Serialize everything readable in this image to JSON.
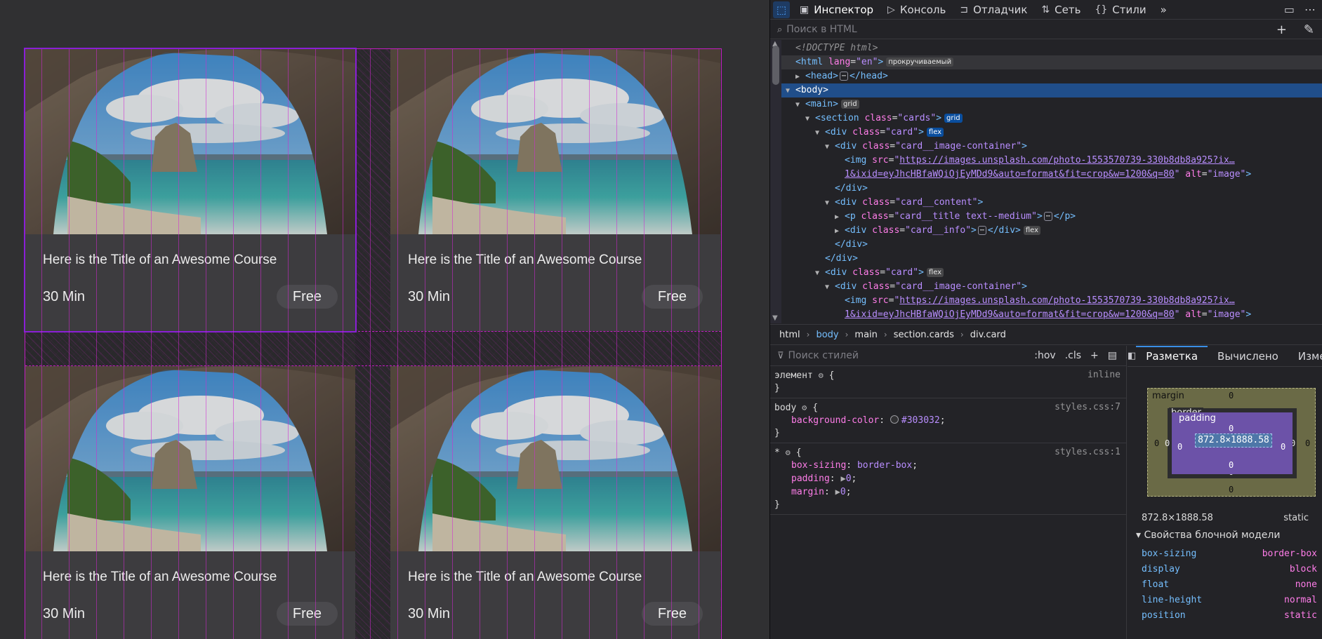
{
  "cards": [
    {
      "title": "Here is the Title of an Awesome Course",
      "time": "30 Min",
      "price": "Free"
    },
    {
      "title": "Here is the Title of an Awesome Course",
      "time": "30 Min",
      "price": "Free"
    },
    {
      "title": "Here is the Title of an Awesome Course",
      "time": "30 Min",
      "price": "Free"
    },
    {
      "title": "Here is the Title of an Awesome Course",
      "time": "30 Min",
      "price": "Free"
    }
  ],
  "devtools": {
    "tabs": [
      {
        "label": "Инспектор",
        "icon": "inspector-icon"
      },
      {
        "label": "Консоль",
        "icon": "console-icon"
      },
      {
        "label": "Отладчик",
        "icon": "debugger-icon"
      },
      {
        "label": "Сеть",
        "icon": "network-icon"
      },
      {
        "label": "Стили",
        "icon": "styles-icon"
      }
    ],
    "html_search_placeholder": "Поиск в HTML",
    "tree": {
      "doctype": "<!DOCTYPE html>",
      "html_lang_attr": "lang",
      "html_lang_val": "\"en\"",
      "badge_scroll": "прокручиваемый",
      "badge_grid": "grid",
      "badge_flex": "flex",
      "class_cards": "\"cards\"",
      "class_card": "\"card\"",
      "class_img_container": "\"card__image-container\"",
      "img_src_line1": "https://images.unsplash.com/photo-1553570739-330b8db8a925?ix…",
      "img_src_line2": "1&ixid=eyJhcHBfaWQiOjEyMDd9&auto=format&fit=crop&w=1200&q=80",
      "img_alt": "\"image\"",
      "class_content": "\"card__content\"",
      "class_title": "\"card__title text--medium\"",
      "class_info": "\"card__info\""
    },
    "breadcrumb": [
      "html",
      "body",
      "main",
      "section.cards",
      "div.card"
    ],
    "styles_search_placeholder": "Поиск стилей",
    "styles_buttons": [
      ":hov",
      ".cls"
    ],
    "rules": {
      "element_selector": "элемент",
      "element_source": "inline",
      "body_selector": "body",
      "body_source": "styles.css:7",
      "body_prop": "background-color",
      "body_val": "#303032",
      "star_selector": "*",
      "star_source": "styles.css:1",
      "star_decls": [
        {
          "prop": "box-sizing",
          "val": "border-box"
        },
        {
          "prop": "padding",
          "val": "0"
        },
        {
          "prop": "margin",
          "val": "0"
        }
      ]
    },
    "layout_tabs": [
      "Разметка",
      "Вычислено",
      "Изме"
    ],
    "box_model": {
      "margin_label": "margin",
      "border_label": "border",
      "padding_label": "padding",
      "content": "872.8×1888.58",
      "zero": "0"
    },
    "dims_value": "872.8×1888.58",
    "dims_position": "static",
    "props_heading": "Свойства блочной модели",
    "props": [
      {
        "k": "box-sizing",
        "v": "border-box"
      },
      {
        "k": "display",
        "v": "block"
      },
      {
        "k": "float",
        "v": "none"
      },
      {
        "k": "line-height",
        "v": "normal"
      },
      {
        "k": "position",
        "v": "static"
      }
    ]
  }
}
